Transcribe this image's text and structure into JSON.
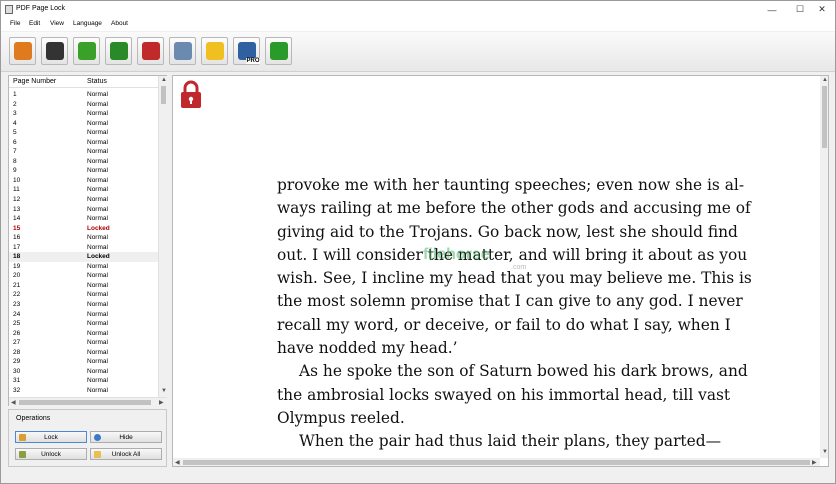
{
  "window": {
    "title": "PDF Page Lock",
    "controls": [
      "—",
      "☐",
      "✕"
    ]
  },
  "menu": [
    "File",
    "Edit",
    "View",
    "Language",
    "About"
  ],
  "toolbar": [
    {
      "name": "open-icon",
      "color": "#e07a1f"
    },
    {
      "name": "save-icon",
      "color": "#333333"
    },
    {
      "name": "check-icon",
      "color": "#3aa02a"
    },
    {
      "name": "zoom-in-icon",
      "color": "#2a8a2a"
    },
    {
      "name": "zoom-out-icon",
      "color": "#c02a2a"
    },
    {
      "name": "settings-icon",
      "color": "#6a8ab0"
    },
    {
      "name": "bulb-icon",
      "color": "#f0c020"
    },
    {
      "name": "pro-users-icon",
      "color": "#3060a0",
      "label": "PRO"
    },
    {
      "name": "next-arrow-icon",
      "color": "#2a9a2a"
    }
  ],
  "list": {
    "headers": {
      "page": "Page Number",
      "status": "Status"
    },
    "rows": [
      {
        "page": "1",
        "status": "Normal"
      },
      {
        "page": "2",
        "status": "Normal"
      },
      {
        "page": "3",
        "status": "Normal"
      },
      {
        "page": "4",
        "status": "Normal"
      },
      {
        "page": "5",
        "status": "Normal"
      },
      {
        "page": "6",
        "status": "Normal"
      },
      {
        "page": "7",
        "status": "Normal"
      },
      {
        "page": "8",
        "status": "Normal"
      },
      {
        "page": "9",
        "status": "Normal"
      },
      {
        "page": "10",
        "status": "Normal"
      },
      {
        "page": "11",
        "status": "Normal"
      },
      {
        "page": "12",
        "status": "Normal"
      },
      {
        "page": "13",
        "status": "Normal"
      },
      {
        "page": "14",
        "status": "Normal"
      },
      {
        "page": "15",
        "status": "Locked",
        "locked": true
      },
      {
        "page": "16",
        "status": "Normal"
      },
      {
        "page": "17",
        "status": "Normal"
      },
      {
        "page": "18",
        "status": "Locked",
        "selected": true
      },
      {
        "page": "19",
        "status": "Normal"
      },
      {
        "page": "20",
        "status": "Normal"
      },
      {
        "page": "21",
        "status": "Normal"
      },
      {
        "page": "22",
        "status": "Normal"
      },
      {
        "page": "23",
        "status": "Normal"
      },
      {
        "page": "24",
        "status": "Normal"
      },
      {
        "page": "25",
        "status": "Normal"
      },
      {
        "page": "26",
        "status": "Normal"
      },
      {
        "page": "27",
        "status": "Normal"
      },
      {
        "page": "28",
        "status": "Normal"
      },
      {
        "page": "29",
        "status": "Normal"
      },
      {
        "page": "30",
        "status": "Normal"
      },
      {
        "page": "31",
        "status": "Normal"
      },
      {
        "page": "32",
        "status": "Normal"
      }
    ]
  },
  "operations": {
    "label": "Operations",
    "lock": "Lock",
    "hide": "Hide",
    "unlock": "Unlock",
    "unlock_all": "Unlock All"
  },
  "document": {
    "lines": [
      {
        "t": "provoke me with her taunting speeches; even now she is al-",
        "indent": false
      },
      {
        "t": "ways railing at me before the other gods and accusing me of",
        "indent": false
      },
      {
        "t": "giving aid to the Trojans. Go back now, lest she should find",
        "indent": false
      },
      {
        "t": "out. I will consider the matter, and will bring it about as you",
        "indent": false
      },
      {
        "t": "wish. See, I incline my head that you may believe me. This is",
        "indent": false
      },
      {
        "t": "the most solemn promise that I can give to any god. I never",
        "indent": false
      },
      {
        "t": "recall my word, or deceive, or fail to do what I say, when I",
        "indent": false
      },
      {
        "t": "have nodded my head.’",
        "indent": false
      },
      {
        "t": "As he spoke the son of Saturn bowed his dark brows, and",
        "indent": true
      },
      {
        "t": "the ambrosial locks swayed on his immortal head, till vast",
        "indent": false
      },
      {
        "t": "Olympus reeled.",
        "indent": false
      },
      {
        "t": "When the pair had thus laid their plans, they parted—",
        "indent": true
      }
    ],
    "watermark": "filehorse",
    "watermark_tld": ".com"
  },
  "colors": {
    "locked": "#b00000",
    "lock_icon": "#c0282d"
  }
}
